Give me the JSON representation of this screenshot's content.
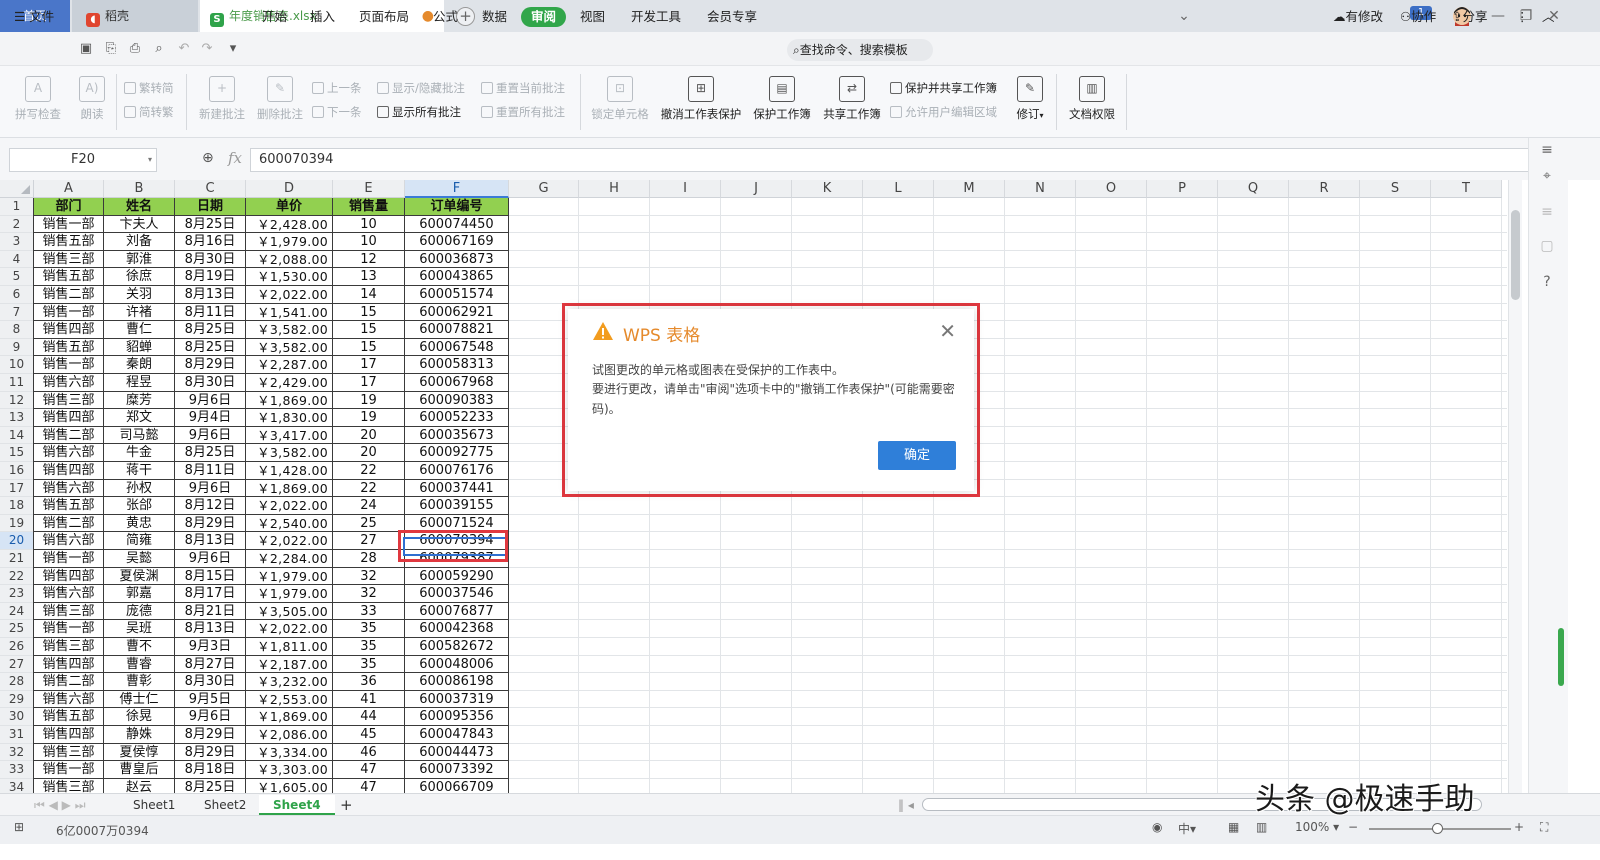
{
  "tabs": {
    "home": "首页",
    "docer": "稻壳",
    "file": "年度销售表.xlsx"
  },
  "notif_count": "1",
  "menu": {
    "file": "文件",
    "items": [
      "开始",
      "插入",
      "页面布局",
      "公式",
      "数据",
      "审阅",
      "视图",
      "开发工具",
      "会员专享"
    ],
    "active": "审阅",
    "search": "查找命令、搜索模板",
    "modified": "有修改",
    "collab": "协作",
    "share": "分享"
  },
  "ribbon": {
    "spellcheck": "拼写检查",
    "read": "朗读",
    "trad_to_simp": "繁转简",
    "simp_to_trad": "简转繁",
    "new_comment": "新建批注",
    "delete_comment": "删除批注",
    "prev": "上一条",
    "next": "下一条",
    "show_hide_comment": "显示/隐藏批注",
    "show_all_comments": "显示所有批注",
    "reset_current_comment": "重置当前批注",
    "reset_all_comments": "重置所有批注",
    "lock_cell": "锁定单元格",
    "unprotect_sheet": "撤消工作表保护",
    "protect_workbook": "保护工作簿",
    "share_workbook": "共享工作簿",
    "protect_and_share": "保护并共享工作簿",
    "allow_edit_ranges": "允许用户编辑区域",
    "revise": "修订",
    "doc_permission": "文档权限"
  },
  "formula_bar": {
    "name_box": "F20",
    "fx": "fx",
    "value": "600070394"
  },
  "columns": [
    "A",
    "B",
    "C",
    "D",
    "E",
    "F",
    "G",
    "H",
    "I",
    "J",
    "K",
    "L",
    "M",
    "N",
    "O",
    "P",
    "Q",
    "R",
    "S",
    "T"
  ],
  "header_row": [
    "部门",
    "姓名",
    "日期",
    "单价",
    "销售量",
    "订单编号"
  ],
  "rows": [
    [
      "销售一部",
      "卞夫人",
      "8月25日",
      "￥2,428.00",
      "10",
      "600074450"
    ],
    [
      "销售五部",
      "刘备",
      "8月16日",
      "￥1,979.00",
      "10",
      "600067169"
    ],
    [
      "销售三部",
      "郭淮",
      "8月30日",
      "￥2,088.00",
      "12",
      "600036873"
    ],
    [
      "销售五部",
      "徐庶",
      "8月19日",
      "￥1,530.00",
      "13",
      "600043865"
    ],
    [
      "销售二部",
      "关羽",
      "8月13日",
      "￥2,022.00",
      "14",
      "600051574"
    ],
    [
      "销售一部",
      "许褚",
      "8月11日",
      "￥1,541.00",
      "15",
      "600062921"
    ],
    [
      "销售四部",
      "曹仁",
      "8月25日",
      "￥3,582.00",
      "15",
      "600078821"
    ],
    [
      "销售五部",
      "貂蝉",
      "8月25日",
      "￥3,582.00",
      "15",
      "600067548"
    ],
    [
      "销售一部",
      "秦朗",
      "8月29日",
      "￥2,287.00",
      "17",
      "600058313"
    ],
    [
      "销售六部",
      "程昱",
      "8月30日",
      "￥2,429.00",
      "17",
      "600067968"
    ],
    [
      "销售三部",
      "糜芳",
      "9月6日",
      "￥1,869.00",
      "19",
      "600090383"
    ],
    [
      "销售四部",
      "郑文",
      "9月4日",
      "￥1,830.00",
      "19",
      "600052233"
    ],
    [
      "销售二部",
      "司马懿",
      "9月6日",
      "￥3,417.00",
      "20",
      "600035673"
    ],
    [
      "销售六部",
      "牛金",
      "8月25日",
      "￥3,582.00",
      "20",
      "600092775"
    ],
    [
      "销售四部",
      "蒋干",
      "8月11日",
      "￥1,428.00",
      "22",
      "600076176"
    ],
    [
      "销售六部",
      "孙权",
      "9月6日",
      "￥1,869.00",
      "22",
      "600037441"
    ],
    [
      "销售五部",
      "张郃",
      "8月12日",
      "￥2,022.00",
      "24",
      "600039155"
    ],
    [
      "销售二部",
      "黄忠",
      "8月29日",
      "￥2,540.00",
      "25",
      "600071524"
    ],
    [
      "销售六部",
      "简雍",
      "8月13日",
      "￥2,022.00",
      "27",
      "600070394"
    ],
    [
      "销售一部",
      "吴懿",
      "9月6日",
      "￥2,284.00",
      "28",
      "600079387"
    ],
    [
      "销售四部",
      "夏侯渊",
      "8月15日",
      "￥1,979.00",
      "32",
      "600059290"
    ],
    [
      "销售六部",
      "郭嘉",
      "8月17日",
      "￥1,979.00",
      "32",
      "600037546"
    ],
    [
      "销售三部",
      "庞德",
      "8月21日",
      "￥3,505.00",
      "33",
      "600076877"
    ],
    [
      "销售一部",
      "吴班",
      "8月13日",
      "￥2,022.00",
      "35",
      "600042368"
    ],
    [
      "销售三部",
      "曹不",
      "9月3日",
      "￥1,811.00",
      "35",
      "600582672"
    ],
    [
      "销售四部",
      "曹睿",
      "8月27日",
      "￥2,187.00",
      "35",
      "600048006"
    ],
    [
      "销售二部",
      "曹彰",
      "8月30日",
      "￥3,232.00",
      "36",
      "600086198"
    ],
    [
      "销售六部",
      "傅士仁",
      "9月5日",
      "￥2,553.00",
      "41",
      "600037319"
    ],
    [
      "销售五部",
      "徐晃",
      "9月6日",
      "￥1,869.00",
      "44",
      "600095356"
    ],
    [
      "销售四部",
      "静姝",
      "8月29日",
      "￥2,086.00",
      "45",
      "600047843"
    ],
    [
      "销售三部",
      "夏侯惇",
      "8月29日",
      "￥3,334.00",
      "46",
      "600044473"
    ],
    [
      "销售一部",
      "曹皇后",
      "8月18日",
      "￥3,303.00",
      "47",
      "600073392"
    ],
    [
      "销售三部",
      "赵云",
      "8月25日",
      "￥1,605.00",
      "47",
      "600066709"
    ]
  ],
  "selected": {
    "row": 20,
    "col": "F"
  },
  "sheets": [
    "Sheet1",
    "Sheet2",
    "Sheet4"
  ],
  "active_sheet": "Sheet4",
  "status": {
    "sum_text": "6亿0007万0394",
    "zoom": "100%",
    "lang": "中"
  },
  "dialog": {
    "title": "WPS 表格",
    "message_line1": "试图更改的单元格或图表在受保护的工作表中。",
    "message_line2": "要进行更改，请单击\"审阅\"选项卡中的\"撤销工作表保护\"(可能需要密码)。",
    "ok": "确定"
  },
  "watermark": "头条 @极速手助",
  "colors": {
    "header_fill": "#92d050",
    "accent_green": "#31a64a",
    "dialog_button": "#2f7fd9",
    "warning_orange": "#e58a2c",
    "highlight_red": "#e0383f"
  }
}
